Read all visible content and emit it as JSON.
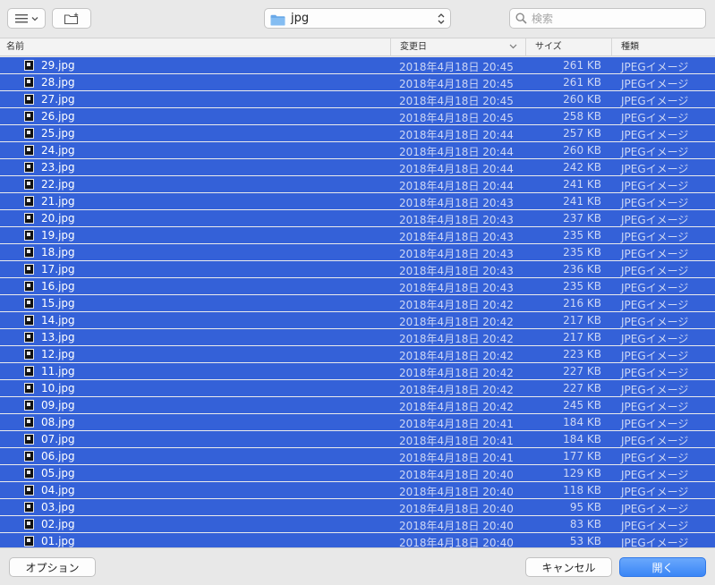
{
  "toolbar": {
    "view_icon": "list-view-icon",
    "new_folder_icon": "new-folder-icon",
    "path_label": "jpg",
    "search_placeholder": "検索"
  },
  "columns": {
    "name": "名前",
    "date": "変更日",
    "size": "サイズ",
    "kind": "種類"
  },
  "files": [
    {
      "name": "29.jpg",
      "date": "2018年4月18日 20:45",
      "size": "261 KB",
      "kind": "JPEGイメージ"
    },
    {
      "name": "28.jpg",
      "date": "2018年4月18日 20:45",
      "size": "261 KB",
      "kind": "JPEGイメージ"
    },
    {
      "name": "27.jpg",
      "date": "2018年4月18日 20:45",
      "size": "260 KB",
      "kind": "JPEGイメージ"
    },
    {
      "name": "26.jpg",
      "date": "2018年4月18日 20:45",
      "size": "258 KB",
      "kind": "JPEGイメージ"
    },
    {
      "name": "25.jpg",
      "date": "2018年4月18日 20:44",
      "size": "257 KB",
      "kind": "JPEGイメージ"
    },
    {
      "name": "24.jpg",
      "date": "2018年4月18日 20:44",
      "size": "260 KB",
      "kind": "JPEGイメージ"
    },
    {
      "name": "23.jpg",
      "date": "2018年4月18日 20:44",
      "size": "242 KB",
      "kind": "JPEGイメージ"
    },
    {
      "name": "22.jpg",
      "date": "2018年4月18日 20:44",
      "size": "241 KB",
      "kind": "JPEGイメージ"
    },
    {
      "name": "21.jpg",
      "date": "2018年4月18日 20:43",
      "size": "241 KB",
      "kind": "JPEGイメージ"
    },
    {
      "name": "20.jpg",
      "date": "2018年4月18日 20:43",
      "size": "237 KB",
      "kind": "JPEGイメージ"
    },
    {
      "name": "19.jpg",
      "date": "2018年4月18日 20:43",
      "size": "235 KB",
      "kind": "JPEGイメージ"
    },
    {
      "name": "18.jpg",
      "date": "2018年4月18日 20:43",
      "size": "235 KB",
      "kind": "JPEGイメージ"
    },
    {
      "name": "17.jpg",
      "date": "2018年4月18日 20:43",
      "size": "236 KB",
      "kind": "JPEGイメージ"
    },
    {
      "name": "16.jpg",
      "date": "2018年4月18日 20:43",
      "size": "235 KB",
      "kind": "JPEGイメージ"
    },
    {
      "name": "15.jpg",
      "date": "2018年4月18日 20:42",
      "size": "216 KB",
      "kind": "JPEGイメージ"
    },
    {
      "name": "14.jpg",
      "date": "2018年4月18日 20:42",
      "size": "217 KB",
      "kind": "JPEGイメージ"
    },
    {
      "name": "13.jpg",
      "date": "2018年4月18日 20:42",
      "size": "217 KB",
      "kind": "JPEGイメージ"
    },
    {
      "name": "12.jpg",
      "date": "2018年4月18日 20:42",
      "size": "223 KB",
      "kind": "JPEGイメージ"
    },
    {
      "name": "11.jpg",
      "date": "2018年4月18日 20:42",
      "size": "227 KB",
      "kind": "JPEGイメージ"
    },
    {
      "name": "10.jpg",
      "date": "2018年4月18日 20:42",
      "size": "227 KB",
      "kind": "JPEGイメージ"
    },
    {
      "name": "09.jpg",
      "date": "2018年4月18日 20:42",
      "size": "245 KB",
      "kind": "JPEGイメージ"
    },
    {
      "name": "08.jpg",
      "date": "2018年4月18日 20:41",
      "size": "184 KB",
      "kind": "JPEGイメージ"
    },
    {
      "name": "07.jpg",
      "date": "2018年4月18日 20:41",
      "size": "184 KB",
      "kind": "JPEGイメージ"
    },
    {
      "name": "06.jpg",
      "date": "2018年4月18日 20:41",
      "size": "177 KB",
      "kind": "JPEGイメージ"
    },
    {
      "name": "05.jpg",
      "date": "2018年4月18日 20:40",
      "size": "129 KB",
      "kind": "JPEGイメージ"
    },
    {
      "name": "04.jpg",
      "date": "2018年4月18日 20:40",
      "size": "118 KB",
      "kind": "JPEGイメージ"
    },
    {
      "name": "03.jpg",
      "date": "2018年4月18日 20:40",
      "size": "95 KB",
      "kind": "JPEGイメージ"
    },
    {
      "name": "02.jpg",
      "date": "2018年4月18日 20:40",
      "size": "83 KB",
      "kind": "JPEGイメージ"
    },
    {
      "name": "01.jpg",
      "date": "2018年4月18日 20:40",
      "size": "53 KB",
      "kind": "JPEGイメージ"
    }
  ],
  "footer": {
    "options_label": "オプション",
    "cancel_label": "キャンセル",
    "open_label": "開く"
  },
  "colors": {
    "selection": "#3461d8",
    "primary_button": "#3a86f6",
    "folder": "#6aa9e8"
  }
}
